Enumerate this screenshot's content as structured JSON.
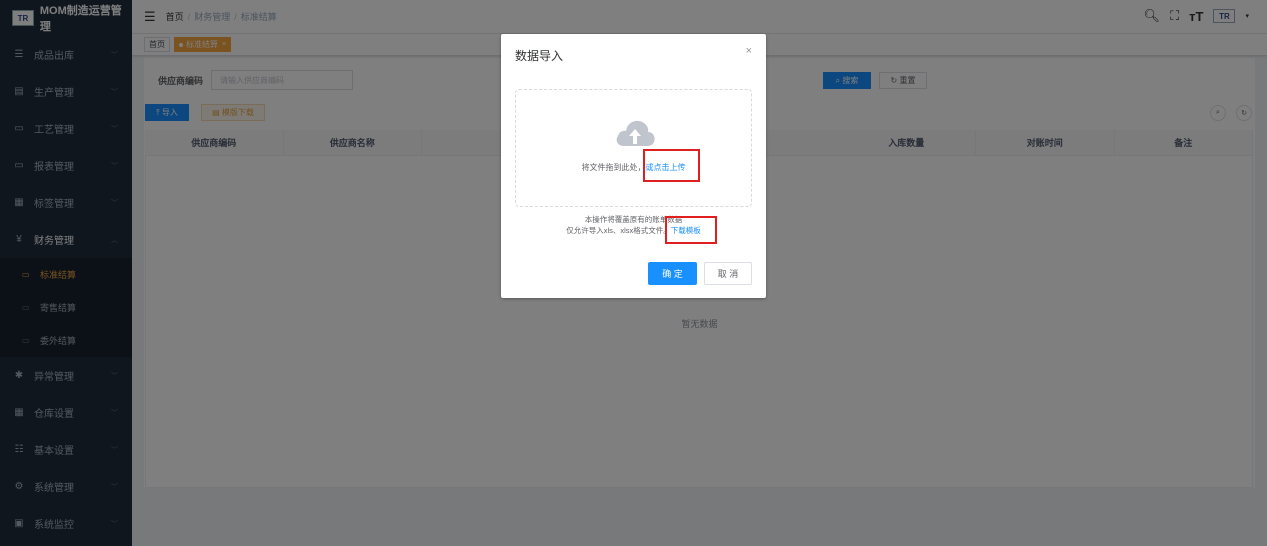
{
  "app": {
    "title": "MOM制造运营管理",
    "logo_text": "TR"
  },
  "sidebar": {
    "items": [
      {
        "label": "成品出库",
        "icon": "list-icon",
        "glyph": "☰"
      },
      {
        "label": "生产管理",
        "icon": "doc-icon",
        "glyph": "▤"
      },
      {
        "label": "工艺管理",
        "icon": "chart-icon",
        "glyph": "▭"
      },
      {
        "label": "报表管理",
        "icon": "chart-icon",
        "glyph": "▭"
      },
      {
        "label": "标签管理",
        "icon": "grid-icon",
        "glyph": "▦"
      },
      {
        "label": "财务管理",
        "icon": "yen-icon",
        "glyph": "¥"
      }
    ],
    "sub_items": [
      {
        "label": "标准结算",
        "active": true
      },
      {
        "label": "寄售结算",
        "active": false
      },
      {
        "label": "委外结算",
        "active": false
      }
    ],
    "items_after": [
      {
        "label": "异常管理",
        "icon": "bug-icon",
        "glyph": "✱"
      },
      {
        "label": "仓库设置",
        "icon": "grid-icon",
        "glyph": "▦"
      },
      {
        "label": "基本设置",
        "icon": "sliders-icon",
        "glyph": "☷"
      },
      {
        "label": "系统管理",
        "icon": "gear-icon",
        "glyph": "⚙"
      },
      {
        "label": "系统监控",
        "icon": "monitor-icon",
        "glyph": "▣"
      }
    ]
  },
  "navbar": {
    "breadcrumb": [
      "首页",
      "财务管理",
      "标准结算"
    ],
    "separator": "/"
  },
  "tags": [
    {
      "label": "首页",
      "active": false
    },
    {
      "label": "标准结算",
      "active": true,
      "close": "×"
    }
  ],
  "search": {
    "label": "供应商编码",
    "placeholder": "请输入供应商编码",
    "search_button": "搜索",
    "reset_button": "重置"
  },
  "toolbar": {
    "import_button": "导入",
    "template_button": "模版下载"
  },
  "table": {
    "columns": [
      "供应商编码",
      "供应商名称",
      "",
      "",
      "",
      "入库数量",
      "对账时间",
      "备注"
    ],
    "empty_text": "暂无数据"
  },
  "dialog": {
    "title": "数据导入",
    "close": "×",
    "upload_text": "将文件拖到此处，",
    "upload_link": "或点击上传",
    "tip_line1": "本操作将覆盖原有的账单数据",
    "tip_line2": "仅允许导入xls、xlsx格式文件。",
    "download_link": "下载模板",
    "ok_button": "确 定",
    "cancel_button": "取 消"
  },
  "colors": {
    "primary": "#1890ff",
    "sidebar_bg": "#1f2d3d",
    "active_accent": "#f4a742",
    "highlight_box": "#e02020"
  }
}
